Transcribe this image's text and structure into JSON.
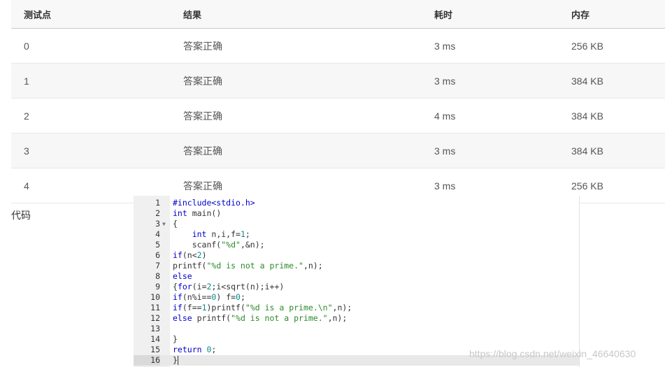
{
  "table": {
    "headers": [
      "测试点",
      "结果",
      "耗时",
      "内存"
    ],
    "rows": [
      {
        "point": "0",
        "result": "答案正确",
        "time": "3 ms",
        "memory": "256 KB"
      },
      {
        "point": "1",
        "result": "答案正确",
        "time": "3 ms",
        "memory": "384 KB"
      },
      {
        "point": "2",
        "result": "答案正确",
        "time": "4 ms",
        "memory": "384 KB"
      },
      {
        "point": "3",
        "result": "答案正确",
        "time": "3 ms",
        "memory": "384 KB"
      },
      {
        "point": "4",
        "result": "答案正确",
        "time": "3 ms",
        "memory": "256 KB"
      }
    ]
  },
  "code_section": {
    "label": "代码",
    "lines": [
      {
        "n": "1",
        "text": "#include<stdio.h>"
      },
      {
        "n": "2",
        "text": "int main()"
      },
      {
        "n": "3",
        "text": "{",
        "fold": true
      },
      {
        "n": "4",
        "text": "    int n,i,f=1;"
      },
      {
        "n": "5",
        "text": "    scanf(\"%d\",&n);"
      },
      {
        "n": "6",
        "text": "if(n<2)"
      },
      {
        "n": "7",
        "text": "printf(\"%d is not a prime.\",n);"
      },
      {
        "n": "8",
        "text": "else"
      },
      {
        "n": "9",
        "text": "{for(i=2;i<sqrt(n);i++)"
      },
      {
        "n": "10",
        "text": "if(n%i==0) f=0;"
      },
      {
        "n": "11",
        "text": "if(f==1)printf(\"%d is a prime.\\n\",n);"
      },
      {
        "n": "12",
        "text": "else printf(\"%d is not a prime.\",n);"
      },
      {
        "n": "13",
        "text": ""
      },
      {
        "n": "14",
        "text": "}"
      },
      {
        "n": "15",
        "text": "return 0;"
      },
      {
        "n": "16",
        "text": "}",
        "active": true
      }
    ]
  },
  "watermark": "https://blog.csdn.net/weixin_46640630",
  "colors": {
    "result_ok": "#e0353b",
    "keyword": "#0000cc",
    "string": "#2a8a2a",
    "number": "#0b8a8a"
  }
}
